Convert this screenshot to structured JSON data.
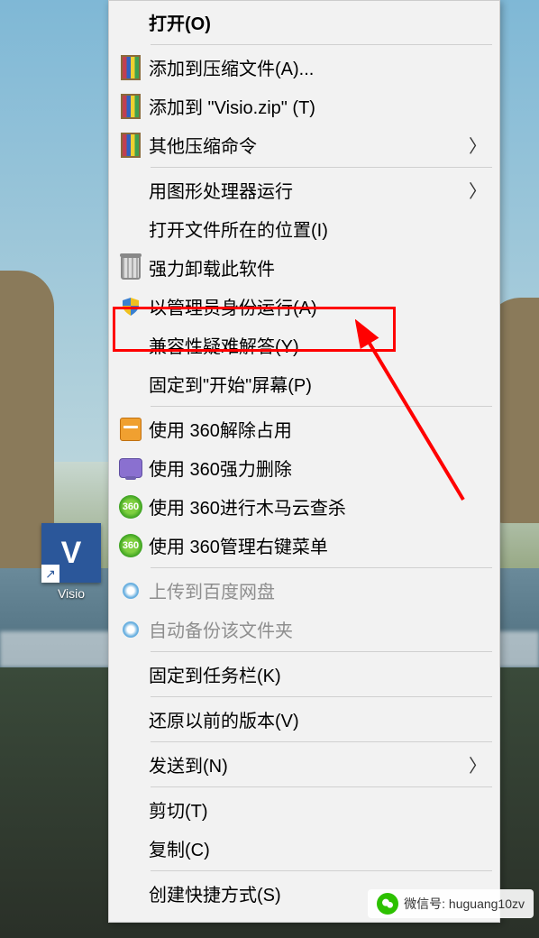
{
  "desktop": {
    "icon_label": "Visio"
  },
  "menu": {
    "open": "打开(O)",
    "zip_add": "添加到压缩文件(A)...",
    "zip_addname": "添加到 \"Visio.zip\" (T)",
    "zip_other": "其他压缩命令",
    "run_gpu": "用图形处理器运行",
    "open_loc": "打开文件所在的位置(I)",
    "force_uninstall": "强力卸载此软件",
    "run_as_admin": "以管理员身份运行(A)",
    "compat": "兼容性疑难解答(Y)",
    "pin_start": "固定到\"开始\"屏幕(P)",
    "s360_unlock": "使用 360解除占用",
    "s360_delete": "使用 360强力删除",
    "s360_trojan": "使用 360进行木马云查杀",
    "s360_menu": "使用 360管理右键菜单",
    "baidu_upload": "上传到百度网盘",
    "baidu_backup": "自动备份该文件夹",
    "pin_taskbar": "固定到任务栏(K)",
    "restore": "还原以前的版本(V)",
    "sendto": "发送到(N)",
    "cut": "剪切(T)",
    "copy": "复制(C)",
    "shortcut": "创建快捷方式(S)"
  },
  "footer": {
    "label": "微信号",
    "handle": "huguang10zv"
  }
}
